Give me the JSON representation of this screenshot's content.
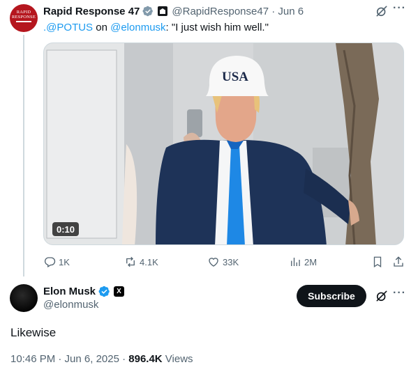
{
  "original_tweet": {
    "avatar_text": [
      "RAPID",
      "RESPONSE"
    ],
    "author_name": "Rapid Response 47",
    "handle_date": "@RapidResponse47 · Jun 6",
    "text_parts": [
      {
        "text": ".@POTUS",
        "mention": true
      },
      {
        "text": " on ",
        "mention": false
      },
      {
        "text": "@elonmusk",
        "mention": true
      },
      {
        "text": ": \"I just wish him well.\"",
        "mention": false
      }
    ],
    "media": {
      "hat_text": "USA",
      "video_time": "0:10"
    },
    "actions": {
      "reply_count": "1K",
      "repost_count": "4.1K",
      "like_count": "33K",
      "view_count": "2M"
    }
  },
  "reply_tweet": {
    "author_name": "Elon Musk",
    "handle": "@elonmusk",
    "x_badge": "X",
    "subscribe_label": "Subscribe",
    "text": "Likewise",
    "time_date": "10:46 PM · Jun 6, 2025 · ",
    "views_count": "896.4K",
    "views_label": " Views"
  },
  "icons": {
    "verified_gray": "verified-badge-gray-icon",
    "affiliate": "white-house-affiliate-icon",
    "grok": "grok-icon",
    "more": "more-icon",
    "reply": "reply-icon",
    "repost": "repost-icon",
    "like": "like-icon",
    "views": "views-icon",
    "bookmark": "bookmark-icon",
    "share": "share-icon",
    "verified_blue": "verified-badge-blue-icon"
  },
  "colors": {
    "link_blue": "#1d9bf0",
    "secondary_text": "#536471",
    "primary_text": "#0f1419",
    "rr_red": "#b5161e"
  }
}
